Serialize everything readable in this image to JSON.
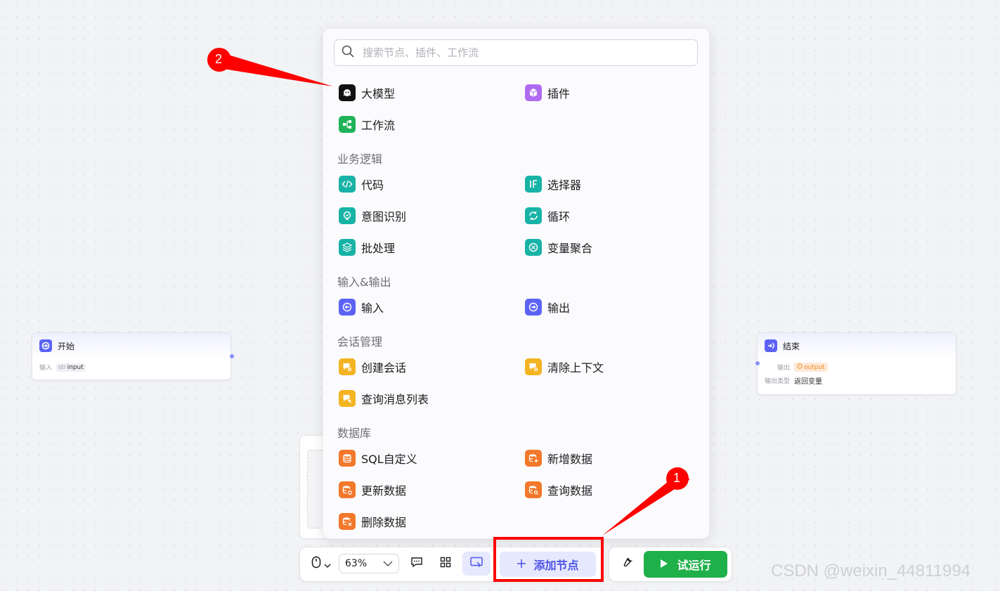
{
  "start_node": {
    "title": "开始",
    "row_label": "输入",
    "param_type": "str",
    "param_name": "input"
  },
  "end_node": {
    "title": "结束",
    "output_label": "输出",
    "output_name": "output",
    "type_label": "输出类型",
    "type_value": "返回变量"
  },
  "popup": {
    "search_placeholder": "搜索节点、插件、工作流",
    "top_items": [
      {
        "label": "大模型",
        "icon": "llm-icon"
      },
      {
        "label": "插件",
        "icon": "plugin-cube-icon"
      },
      {
        "label": "工作流",
        "icon": "workflow-icon"
      }
    ],
    "sections": [
      {
        "title": "业务逻辑",
        "items": [
          {
            "label": "代码",
            "icon": "code-icon"
          },
          {
            "label": "选择器",
            "icon": "if-icon"
          },
          {
            "label": "意图识别",
            "icon": "intent-icon"
          },
          {
            "label": "循环",
            "icon": "loop-icon"
          },
          {
            "label": "批处理",
            "icon": "batch-icon"
          },
          {
            "label": "变量聚合",
            "icon": "aggregate-icon"
          }
        ]
      },
      {
        "title": "输入&输出",
        "items": [
          {
            "label": "输入",
            "icon": "input-icon"
          },
          {
            "label": "输出",
            "icon": "output-icon"
          }
        ]
      },
      {
        "title": "会话管理",
        "items": [
          {
            "label": "创建会话",
            "icon": "create-conversation-icon"
          },
          {
            "label": "清除上下文",
            "icon": "clear-context-icon"
          },
          {
            "label": "查询消息列表",
            "icon": "message-list-icon"
          }
        ]
      },
      {
        "title": "数据库",
        "items": [
          {
            "label": "SQL自定义",
            "icon": "database-icon"
          },
          {
            "label": "新增数据",
            "icon": "database-add-icon"
          },
          {
            "label": "更新数据",
            "icon": "database-update-icon"
          },
          {
            "label": "查询数据",
            "icon": "database-query-icon"
          },
          {
            "label": "删除数据",
            "icon": "database-delete-icon"
          }
        ]
      }
    ]
  },
  "toolbar": {
    "zoom": "63%",
    "add_node_label": "添加节点",
    "run_label": "试运行"
  },
  "annotations": {
    "badge_1": "1",
    "badge_2": "2"
  },
  "colors": {
    "accent": "#5b63f5",
    "run_green": "#1fb04a",
    "highlight_red": "#ff0000"
  },
  "watermark": "CSDN @weixin_44811994"
}
